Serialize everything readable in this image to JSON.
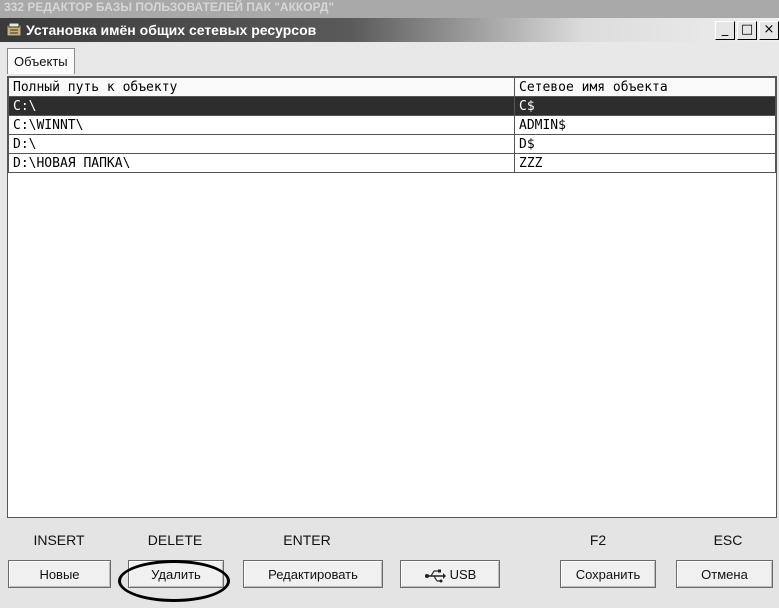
{
  "background_window": {
    "title": "332 РЕДАКТОР БАЗЫ ПОЛЬЗОВАТЕЛЕЙ ПАК \"АККОРД\""
  },
  "window": {
    "title": "Установка имён общих сетевых ресурсов",
    "controls": {
      "minimize": "_",
      "maximize": "□",
      "close": "×"
    }
  },
  "tabs": [
    {
      "label": "Объекты",
      "active": true
    }
  ],
  "table": {
    "columns": [
      "Полный путь к объекту",
      "Сетевое имя объекта"
    ],
    "rows": [
      {
        "path": "C:\\",
        "share": "C$",
        "selected": true
      },
      {
        "path": "C:\\WINNT\\",
        "share": "ADMIN$",
        "selected": false
      },
      {
        "path": "D:\\",
        "share": "D$",
        "selected": false
      },
      {
        "path": "D:\\НОВАЯ ПАПКА\\",
        "share": "ZZZ",
        "selected": false
      }
    ]
  },
  "buttons": {
    "new": {
      "key": "INSERT",
      "label": "Новые"
    },
    "delete": {
      "key": "DELETE",
      "label": "Удалить"
    },
    "edit": {
      "key": "ENTER",
      "label": "Редактировать"
    },
    "usb": {
      "label": "USB",
      "icon": "usb-icon"
    },
    "save": {
      "key": "F2",
      "label": "Сохранить"
    },
    "cancel": {
      "key": "ESC",
      "label": "Отмена"
    }
  },
  "colors": {
    "selected_row": "#2d2d2d",
    "title_bar": "#3a3a3a"
  }
}
